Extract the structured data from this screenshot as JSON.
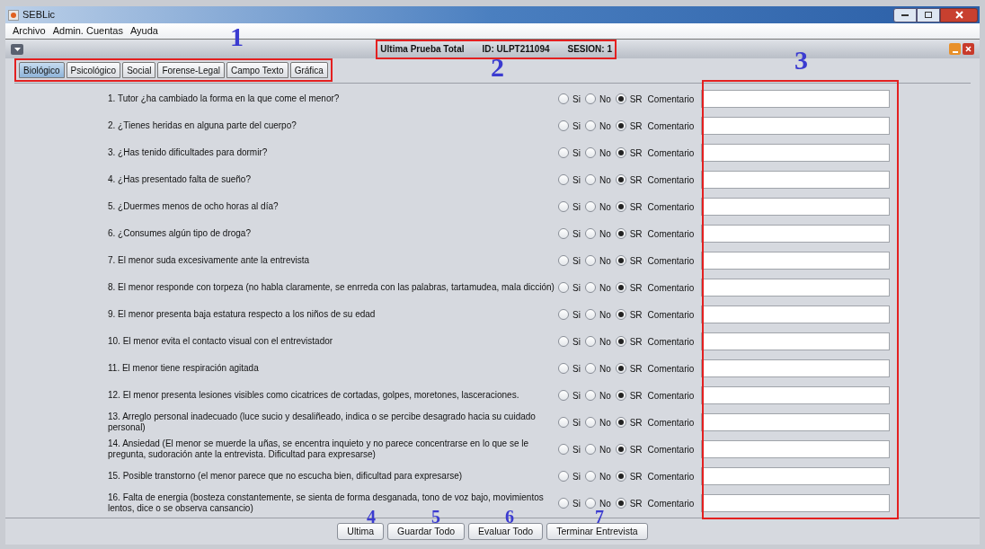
{
  "window": {
    "title": "SEBLic"
  },
  "menu": [
    "Archivo",
    "Admin. Cuentas",
    "Ayuda"
  ],
  "header": {
    "test": "Ultima Prueba Total",
    "id": "ID: ULPT211094",
    "session": "SESION: 1"
  },
  "tabs": [
    {
      "label": "Biológico",
      "selected": true
    },
    {
      "label": "Psicológico",
      "selected": false
    },
    {
      "label": "Social",
      "selected": false
    },
    {
      "label": "Forense-Legal",
      "selected": false
    },
    {
      "label": "Campo Texto",
      "selected": false
    },
    {
      "label": "Gráfica",
      "selected": false
    }
  ],
  "questions": [
    {
      "text": "1. Tutor ¿ha cambiado la forma en la que come el menor?",
      "options": [
        {
          "label": "Si",
          "selected": false
        },
        {
          "label": "No",
          "selected": false
        },
        {
          "label": "SR",
          "selected": true
        }
      ],
      "comment_label": "Comentario"
    },
    {
      "text": "2. ¿Tienes heridas en alguna parte del cuerpo?",
      "options": [
        {
          "label": "Si",
          "selected": false
        },
        {
          "label": "No",
          "selected": false
        },
        {
          "label": "SR",
          "selected": true
        }
      ],
      "comment_label": "Comentario"
    },
    {
      "text": "3. ¿Has tenido dificultades para dormir?",
      "options": [
        {
          "label": "Si",
          "selected": false
        },
        {
          "label": "No",
          "selected": false
        },
        {
          "label": "SR",
          "selected": true
        }
      ],
      "comment_label": "Comentario"
    },
    {
      "text": "4. ¿Has presentado falta de sueño?",
      "options": [
        {
          "label": "Si",
          "selected": false
        },
        {
          "label": "No",
          "selected": false
        },
        {
          "label": "SR",
          "selected": true
        }
      ],
      "comment_label": "Comentario"
    },
    {
      "text": "5. ¿Duermes menos de ocho horas al día?",
      "options": [
        {
          "label": "Si",
          "selected": false
        },
        {
          "label": "No",
          "selected": false
        },
        {
          "label": "SR",
          "selected": true
        }
      ],
      "comment_label": "Comentario"
    },
    {
      "text": "6. ¿Consumes algún tipo de droga?",
      "options": [
        {
          "label": "Si",
          "selected": false
        },
        {
          "label": "No",
          "selected": false
        },
        {
          "label": "SR",
          "selected": true
        }
      ],
      "comment_label": "Comentario"
    },
    {
      "text": "7. El menor suda excesivamente ante la entrevista",
      "options": [
        {
          "label": "Si",
          "selected": false
        },
        {
          "label": "No",
          "selected": false
        },
        {
          "label": "SR",
          "selected": true
        }
      ],
      "comment_label": "Comentario"
    },
    {
      "text": "8. El menor responde con torpeza (no habla claramente, se enrreda con las palabras, tartamudea, mala dicción)",
      "options": [
        {
          "label": "Si",
          "selected": false
        },
        {
          "label": "No",
          "selected": false
        },
        {
          "label": "SR",
          "selected": true
        }
      ],
      "comment_label": "Comentario"
    },
    {
      "text": "9. El menor presenta baja estatura respecto a los niños de su edad",
      "options": [
        {
          "label": "Si",
          "selected": false
        },
        {
          "label": "No",
          "selected": false
        },
        {
          "label": "SR",
          "selected": true
        }
      ],
      "comment_label": "Comentario"
    },
    {
      "text": "10. El menor evita el contacto visual con el entrevistador",
      "options": [
        {
          "label": "Si",
          "selected": false
        },
        {
          "label": "No",
          "selected": false
        },
        {
          "label": "SR",
          "selected": true
        }
      ],
      "comment_label": "Comentario"
    },
    {
      "text": "11. El menor tiene respiración agitada",
      "options": [
        {
          "label": "Si",
          "selected": false
        },
        {
          "label": "No",
          "selected": false
        },
        {
          "label": "SR",
          "selected": true
        }
      ],
      "comment_label": "Comentario"
    },
    {
      "text": "12. El menor presenta lesiones visibles como cicatrices de cortadas, golpes, moretones, lasceraciones.",
      "options": [
        {
          "label": "Si",
          "selected": false
        },
        {
          "label": "No",
          "selected": false
        },
        {
          "label": "SR",
          "selected": true
        }
      ],
      "comment_label": "Comentario"
    },
    {
      "text": "13. Arreglo personal inadecuado (luce sucio y desaliñeado, indica o se percibe desagrado hacia su cuidado personal)",
      "options": [
        {
          "label": "Si",
          "selected": false
        },
        {
          "label": "No",
          "selected": false
        },
        {
          "label": "SR",
          "selected": true
        }
      ],
      "comment_label": "Comentario"
    },
    {
      "text": "14. Ansiedad (El menor se muerde la uñas, se encentra inquieto y no parece concentrarse en lo que se le pregunta, sudoración ante la entrevista. Dificultad para expresarse)",
      "options": [
        {
          "label": "Si",
          "selected": false
        },
        {
          "label": "No",
          "selected": false
        },
        {
          "label": "SR",
          "selected": true
        }
      ],
      "comment_label": "Comentario"
    },
    {
      "text": "15. Posible transtorno (el menor parece que no escucha bien, dificultad para expresarse)",
      "options": [
        {
          "label": "Si",
          "selected": false
        },
        {
          "label": "No",
          "selected": false
        },
        {
          "label": "SR",
          "selected": true
        }
      ],
      "comment_label": "Comentario"
    },
    {
      "text": "16. Falta de energia (bosteza constantemente, se sienta de forma desganada, tono de voz bajo, movimientos lentos, dice o se observa cansancio)",
      "options": [
        {
          "label": "Si",
          "selected": false
        },
        {
          "label": "No",
          "selected": false
        },
        {
          "label": "SR",
          "selected": true
        }
      ],
      "comment_label": "Comentario"
    }
  ],
  "buttons": [
    "Ultima",
    "Guardar Todo",
    "Evaluar Todo",
    "Terminar Entrevista"
  ],
  "annotations": [
    "1",
    "2",
    "3",
    "4",
    "5",
    "6",
    "7"
  ]
}
